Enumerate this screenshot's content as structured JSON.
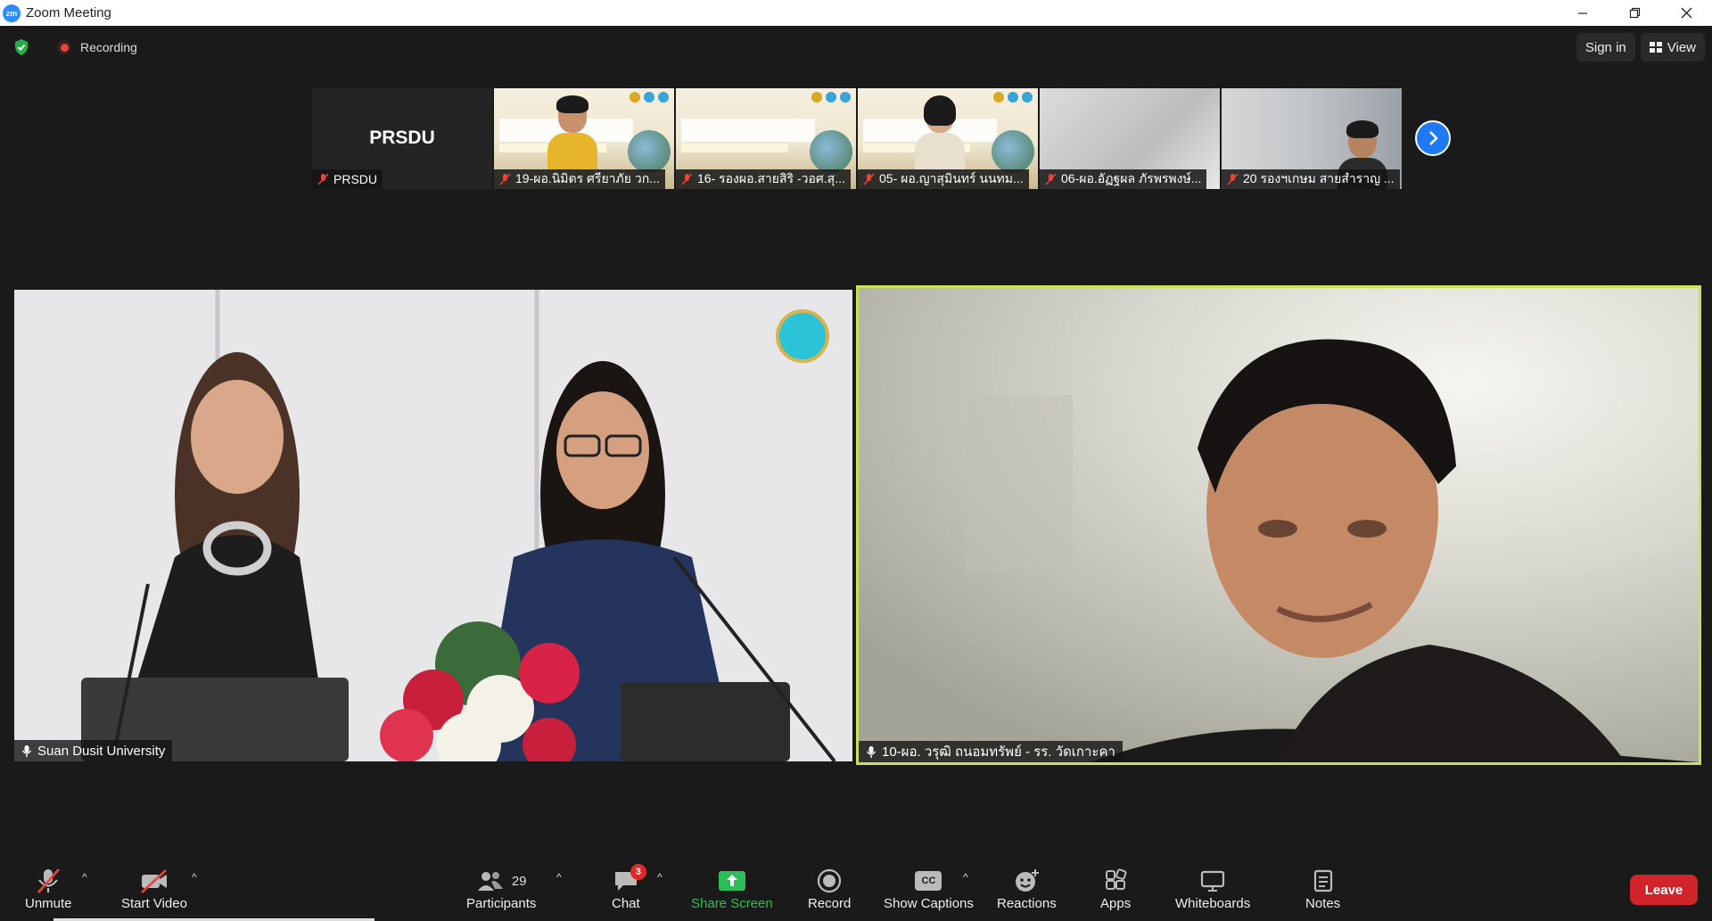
{
  "window": {
    "title": "Zoom Meeting",
    "logo_text": "zm",
    "controls": [
      "minimize",
      "restore",
      "close"
    ]
  },
  "topbar": {
    "recording_label": "Recording",
    "sign_in_label": "Sign in",
    "view_label": "View"
  },
  "thumbnails": [
    {
      "type": "name-only",
      "display_name": "PRSDU",
      "label": "PRSDU"
    },
    {
      "type": "slide",
      "label": "19-ผอ.นิมิตร ศรียาภัย  วก..."
    },
    {
      "type": "slide",
      "label": "16- รองผอ.สายสิริ -วอศ.สุ..."
    },
    {
      "type": "slide",
      "label": "05- ผอ.ญาสุมินทร์ นนทม..."
    },
    {
      "type": "blank",
      "label": "06-ผอ.อัฏฐผล ภัรพรพงษ์..."
    },
    {
      "type": "office",
      "label": "20 รองฯเกษม สายสำราญ ..."
    }
  ],
  "main_videos": [
    {
      "label": "Suan Dusit University",
      "active_speaker": false
    },
    {
      "label": "10-ผอ. วรุฒิ ถนอมทรัพย์ - รร. วัดเกาะคา",
      "active_speaker": true
    }
  ],
  "toolbar": {
    "unmute_label": "Unmute",
    "start_video_label": "Start Video",
    "participants_label": "Participants",
    "participants_count": "29",
    "chat_label": "Chat",
    "chat_badge": "3",
    "share_screen_label": "Share Screen",
    "record_label": "Record",
    "captions_label": "Show Captions",
    "captions_icon_text": "CC",
    "reactions_label": "Reactions",
    "apps_label": "Apps",
    "whiteboards_label": "Whiteboards",
    "notes_label": "Notes",
    "leave_label": "Leave"
  },
  "colors": {
    "accent_blue": "#1d7af3",
    "share_green": "#2ebd59",
    "leave_red": "#d1232a",
    "active_speaker_border": "#c8e05a",
    "mute_red": "#e5453d"
  }
}
